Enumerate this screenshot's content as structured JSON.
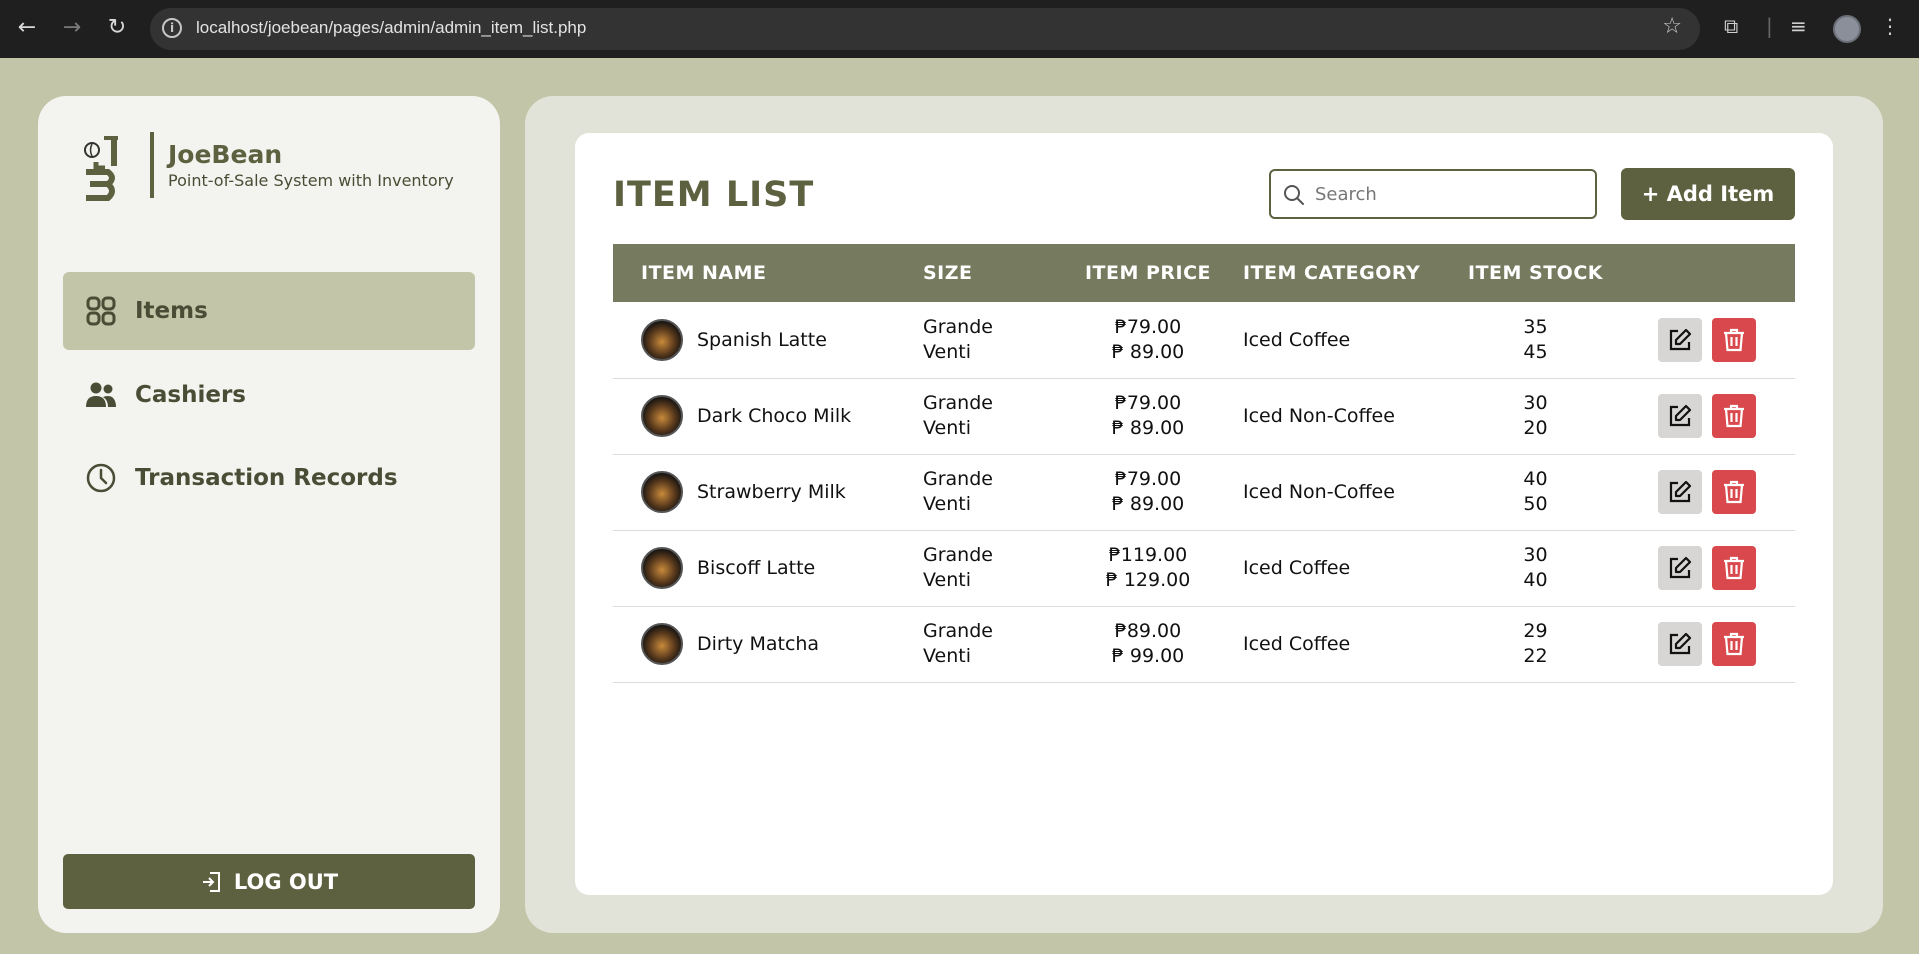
{
  "browser": {
    "url": "localhost/joebean/pages/admin/admin_item_list.php"
  },
  "sidebar": {
    "brand_name": "JoeBean",
    "brand_subtitle": "Point-of-Sale System with Inventory",
    "items": [
      {
        "label": "Items",
        "icon": "grid-icon",
        "active": true
      },
      {
        "label": "Cashiers",
        "icon": "users-icon",
        "active": false
      },
      {
        "label": "Transaction Records",
        "icon": "clock-icon",
        "active": false
      }
    ],
    "logout_label": "LOG OUT"
  },
  "main": {
    "title": "ITEM LIST",
    "search_placeholder": "Search",
    "add_button_label": "+ Add Item",
    "columns": [
      "ITEM NAME",
      "SIZE",
      "ITEM PRICE",
      "ITEM CATEGORY",
      "ITEM STOCK"
    ],
    "rows": [
      {
        "name": "Spanish Latte",
        "size1": "Grande",
        "size2": "Venti",
        "price1": "₱79.00",
        "price2": "₱ 89.00",
        "category": "Iced Coffee",
        "stock1": "35",
        "stock2": "45"
      },
      {
        "name": "Dark Choco Milk",
        "size1": "Grande",
        "size2": "Venti",
        "price1": "₱79.00",
        "price2": "₱ 89.00",
        "category": "Iced Non-Coffee",
        "stock1": "30",
        "stock2": "20"
      },
      {
        "name": "Strawberry Milk",
        "size1": "Grande",
        "size2": "Venti",
        "price1": "₱79.00",
        "price2": "₱ 89.00",
        "category": "Iced Non-Coffee",
        "stock1": "40",
        "stock2": "50"
      },
      {
        "name": "Biscoff Latte",
        "size1": "Grande",
        "size2": "Venti",
        "price1": "₱119.00",
        "price2": "₱ 129.00",
        "category": "Iced Coffee",
        "stock1": "30",
        "stock2": "40"
      },
      {
        "name": "Dirty Matcha",
        "size1": "Grande",
        "size2": "Venti",
        "price1": "₱89.00",
        "price2": "₱ 99.00",
        "category": "Iced Coffee",
        "stock1": "29",
        "stock2": "22"
      }
    ]
  },
  "colors": {
    "olive_dark": "#5d6140",
    "olive_header": "#767a5e",
    "sage_bg": "#c3c5a8",
    "delete_red": "#d9484c"
  }
}
